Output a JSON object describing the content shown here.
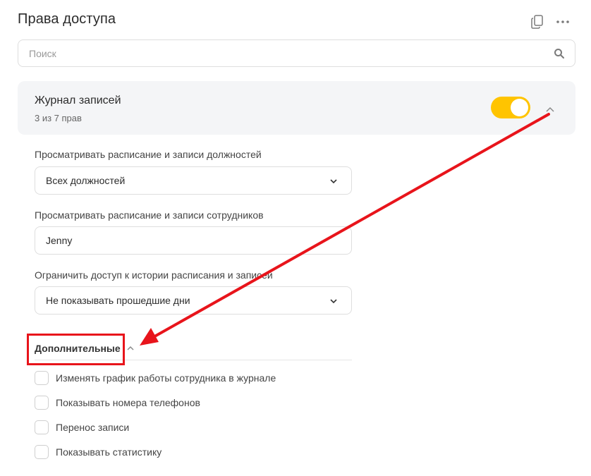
{
  "header": {
    "title": "Права доступа",
    "icons": [
      "copy-icon",
      "more-icon"
    ]
  },
  "search": {
    "placeholder": "Поиск",
    "value": ""
  },
  "section": {
    "title": "Журнал записей",
    "count": "3 из 7 прав",
    "enabled": true,
    "accent_color": "#ffc400"
  },
  "fields": [
    {
      "label": "Просматривать расписание и записи должностей",
      "value": "Всех должностей"
    },
    {
      "label": "Просматривать расписание и записи сотрудников",
      "value": "Jenny"
    },
    {
      "label": "Ограничить доступ к истории расписания и записей",
      "value": "Не показывать прошедшие дни"
    }
  ],
  "extra": {
    "title": "Дополнительные",
    "options": [
      {
        "label": "Изменять график работы сотрудника в журнале",
        "checked": false
      },
      {
        "label": "Показывать номера телефонов",
        "checked": false
      },
      {
        "label": "Перенос записи",
        "checked": false
      },
      {
        "label": "Показывать статистику",
        "checked": false
      }
    ]
  },
  "annotation": {
    "color": "#e8141b"
  }
}
